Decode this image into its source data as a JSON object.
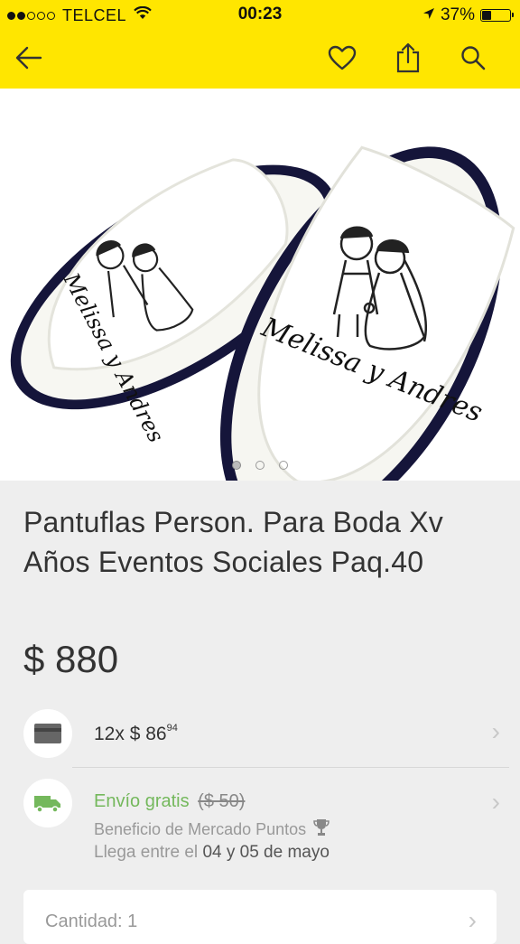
{
  "status_bar": {
    "carrier": "TELCEL",
    "time": "00:23",
    "battery": "37%"
  },
  "toolbar": {
    "icons": [
      "back-arrow-icon",
      "heart-icon",
      "share-icon",
      "search-icon"
    ]
  },
  "gallery": {
    "pages": 3,
    "active_page": 1,
    "image_text": [
      "Melissa y Andres"
    ]
  },
  "product": {
    "title": "Pantuflas Person. Para Boda Xv Años Eventos Sociales Paq.40",
    "price": "$ 880"
  },
  "installments": {
    "prefix": "12x $ 86",
    "cents": "94"
  },
  "shipping": {
    "label": "Envío gratis",
    "original_cost": "($ 50)",
    "benefit": "Beneficio de Mercado Puntos",
    "arrival_prefix": "Llega entre el",
    "arrival_dates": "04 y 05 de mayo"
  },
  "quantity": {
    "label": "Cantidad: 1"
  },
  "colors": {
    "brand_yellow": "#ffe600",
    "ship_green": "#74b85c",
    "slipper_trim": "#1a1a3a"
  }
}
